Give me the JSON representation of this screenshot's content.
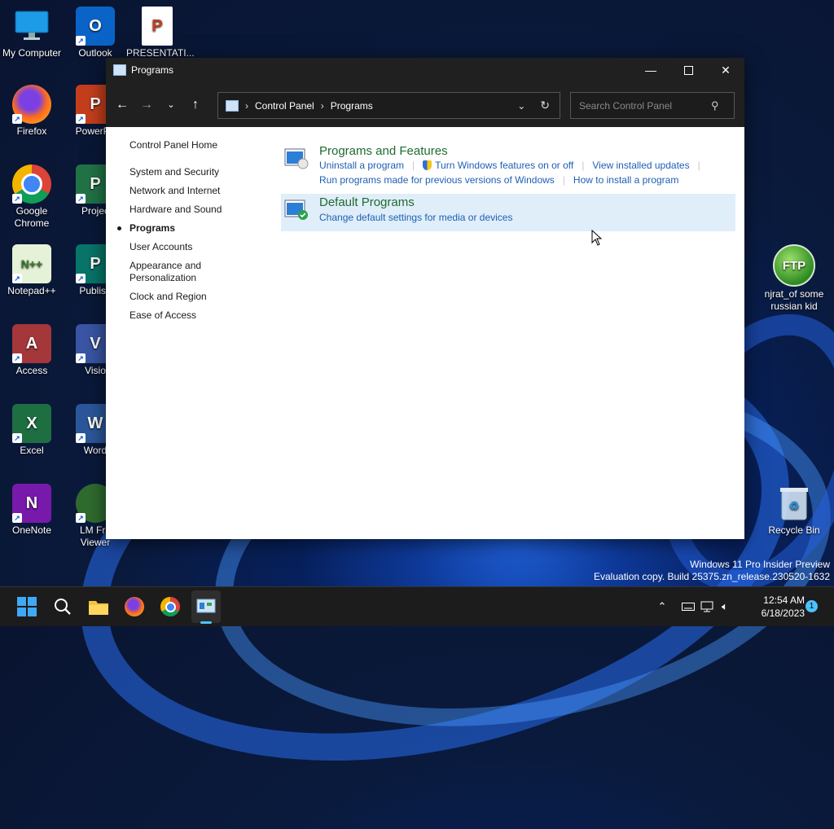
{
  "desktop": {
    "icons": [
      {
        "label": "My Computer"
      },
      {
        "label": "Outlook"
      },
      {
        "label": "PRESENTATI..."
      },
      {
        "label": "Firefox"
      },
      {
        "label": "PowerPo"
      },
      {
        "label": "Google Chrome"
      },
      {
        "label": "Projec"
      },
      {
        "label": "Notepad++"
      },
      {
        "label": "Publish"
      },
      {
        "label": "Access"
      },
      {
        "label": "Visio"
      },
      {
        "label": "Excel"
      },
      {
        "label": "Word"
      },
      {
        "label": "OneNote"
      },
      {
        "label": "LM Fre Viewer"
      },
      {
        "label": "njrat_of some russian kid"
      },
      {
        "label": "Recycle Bin"
      }
    ],
    "watermark_line1": "Windows 11 Pro Insider Preview",
    "watermark_line2": "Evaluation copy. Build 25375.zn_release.230520-1632"
  },
  "window": {
    "title": "Programs",
    "breadcrumb": [
      "Control Panel",
      "Programs"
    ],
    "search_placeholder": "Search Control Panel",
    "left_nav": {
      "home": "Control Panel Home",
      "items": [
        "System and Security",
        "Network and Internet",
        "Hardware and Sound",
        "Programs",
        "User Accounts",
        "Appearance and Personalization",
        "Clock and Region",
        "Ease of Access"
      ],
      "active": "Programs"
    },
    "categories": [
      {
        "title": "Programs and Features",
        "links_row1": [
          "Uninstall a program",
          "Turn Windows features on or off",
          "View installed updates"
        ],
        "links_row2": [
          "Run programs made for previous versions of Windows",
          "How to install a program"
        ]
      },
      {
        "title": "Default Programs",
        "links_row1": [
          "Change default settings for media or devices"
        ]
      }
    ]
  },
  "taskbar": {
    "time": "12:54 AM",
    "date": "6/18/2023",
    "notification_count": "1"
  },
  "colors": {
    "accent": "#0078d4",
    "category_title": "#1e6b2f",
    "link": "#1d5fb4",
    "highlight": "#e0eef9"
  }
}
